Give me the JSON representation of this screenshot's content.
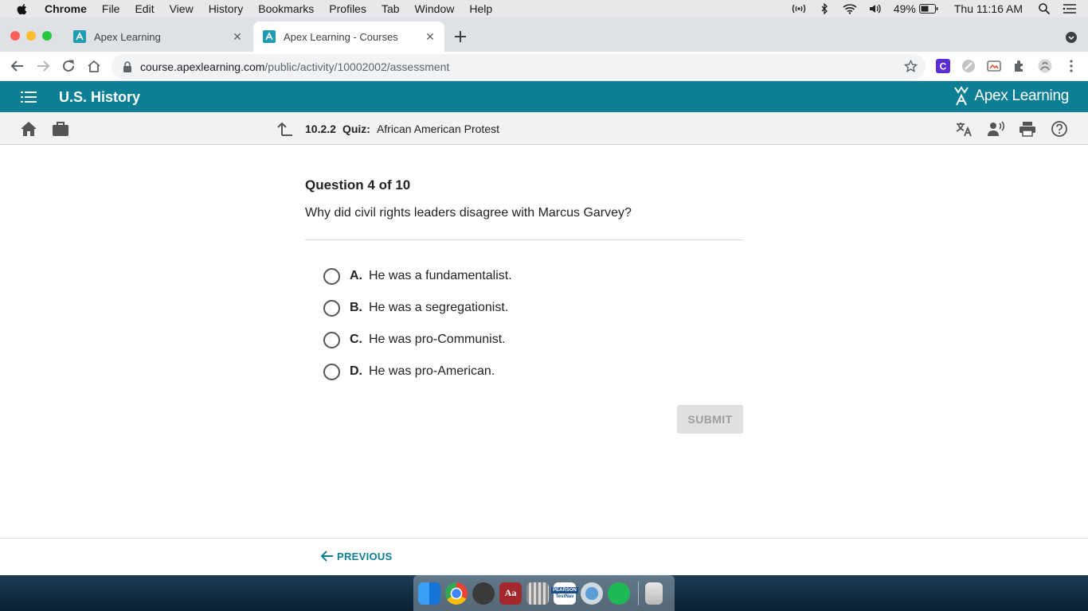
{
  "menubar": {
    "app": "Chrome",
    "items": [
      "File",
      "Edit",
      "View",
      "History",
      "Bookmarks",
      "Profiles",
      "Tab",
      "Window",
      "Help"
    ],
    "battery": "49%",
    "clock": "Thu 11:16 AM"
  },
  "tabs": [
    {
      "title": "Apex Learning",
      "active": false
    },
    {
      "title": "Apex Learning - Courses",
      "active": true
    }
  ],
  "address": {
    "host": "course.apexlearning.com",
    "path": "/public/activity/10002002/assessment"
  },
  "apex": {
    "course_title": "U.S. History",
    "logo_text": "Apex Learning",
    "brand_color": "#0d7f95"
  },
  "breadcrumb": {
    "number": "10.2.2",
    "type": "Quiz:",
    "title": "African American Protest"
  },
  "question": {
    "header": "Question 4 of 10",
    "text": "Why did civil rights leaders disagree with Marcus Garvey?",
    "choices": [
      {
        "letter": "A.",
        "text": "He was a fundamentalist."
      },
      {
        "letter": "B.",
        "text": "He was a segregationist."
      },
      {
        "letter": "C.",
        "text": "He was pro-Communist."
      },
      {
        "letter": "D.",
        "text": "He was pro-American."
      }
    ],
    "submit_label": "SUBMIT"
  },
  "footer": {
    "previous_label": "PREVIOUS"
  },
  "dock": {
    "testnav_label_top": "PEARSON",
    "testnav_label_bottom": "TestNav"
  }
}
